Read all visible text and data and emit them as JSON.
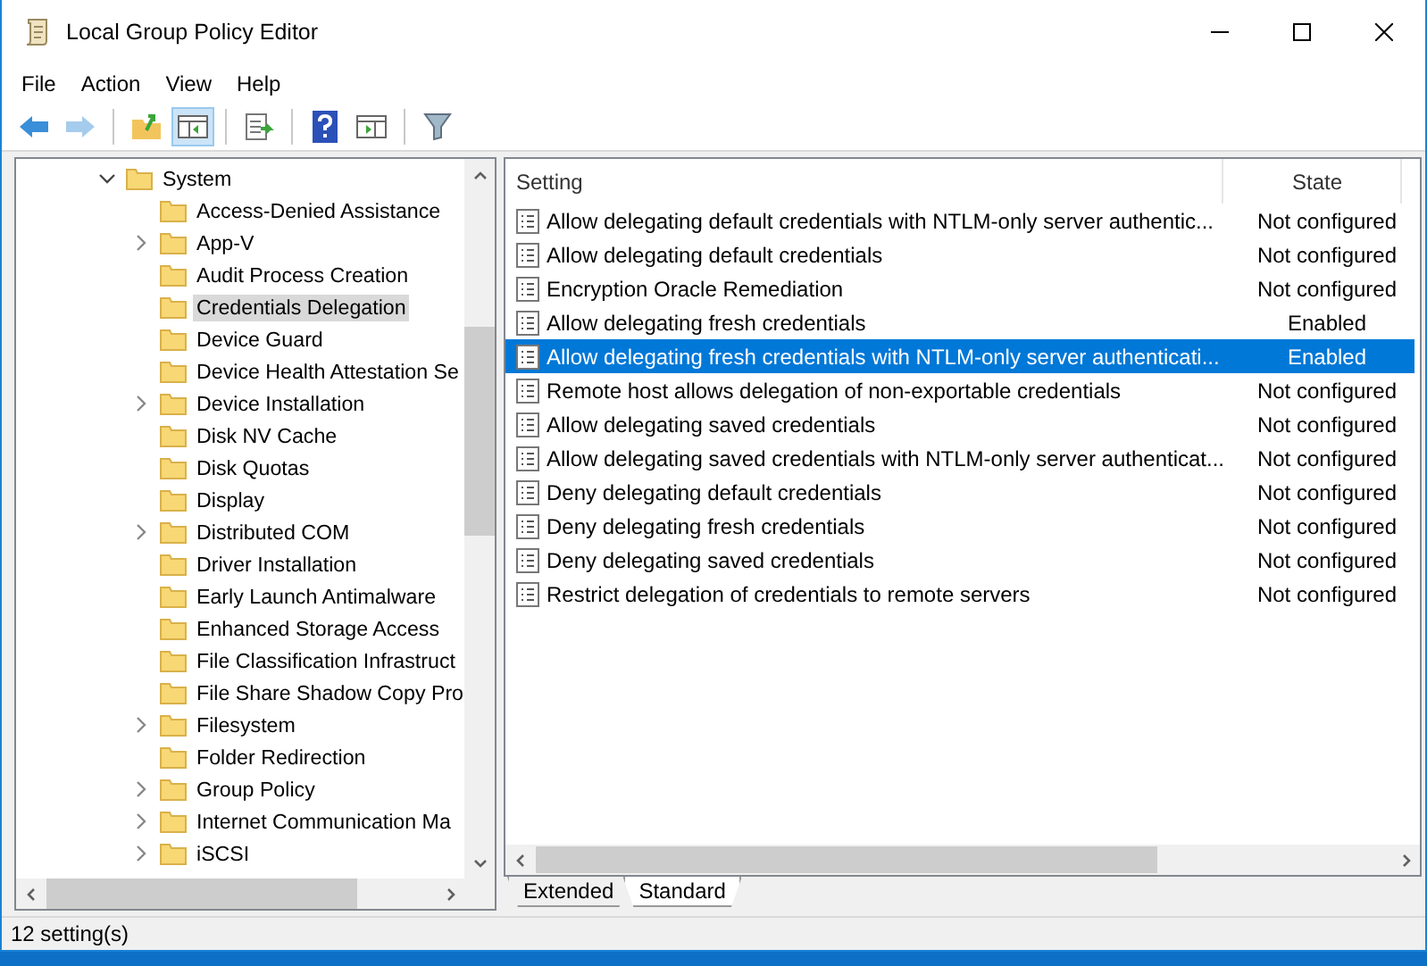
{
  "window": {
    "title": "Local Group Policy Editor"
  },
  "menu": [
    "File",
    "Action",
    "View",
    "Help"
  ],
  "toolbar": [
    {
      "kind": "back",
      "disabled": false,
      "pressed": false
    },
    {
      "kind": "forward",
      "disabled": true,
      "pressed": false
    },
    {
      "kind": "separator"
    },
    {
      "kind": "up",
      "disabled": false,
      "pressed": false
    },
    {
      "kind": "tree",
      "disabled": false,
      "pressed": true
    },
    {
      "kind": "separator"
    },
    {
      "kind": "export",
      "disabled": false,
      "pressed": false
    },
    {
      "kind": "separator"
    },
    {
      "kind": "help",
      "disabled": false,
      "pressed": false
    },
    {
      "kind": "pane",
      "disabled": false,
      "pressed": false
    },
    {
      "kind": "separator"
    },
    {
      "kind": "filter",
      "disabled": false,
      "pressed": false
    }
  ],
  "tree": [
    {
      "label": "System",
      "expanded": true,
      "selected": false,
      "children": [
        {
          "label": "Access-Denied Assistance",
          "expandable": false,
          "selected": false
        },
        {
          "label": "App-V",
          "expandable": true,
          "selected": false
        },
        {
          "label": "Audit Process Creation",
          "expandable": false,
          "selected": false
        },
        {
          "label": "Credentials Delegation",
          "expandable": false,
          "selected": true
        },
        {
          "label": "Device Guard",
          "expandable": false,
          "selected": false
        },
        {
          "label": "Device Health Attestation Se",
          "expandable": false,
          "selected": false
        },
        {
          "label": "Device Installation",
          "expandable": true,
          "selected": false
        },
        {
          "label": "Disk NV Cache",
          "expandable": false,
          "selected": false
        },
        {
          "label": "Disk Quotas",
          "expandable": false,
          "selected": false
        },
        {
          "label": "Display",
          "expandable": false,
          "selected": false
        },
        {
          "label": "Distributed COM",
          "expandable": true,
          "selected": false
        },
        {
          "label": "Driver Installation",
          "expandable": false,
          "selected": false
        },
        {
          "label": "Early Launch Antimalware",
          "expandable": false,
          "selected": false
        },
        {
          "label": "Enhanced Storage Access",
          "expandable": false,
          "selected": false
        },
        {
          "label": "File Classification Infrastruct",
          "expandable": false,
          "selected": false
        },
        {
          "label": "File Share Shadow Copy Pro",
          "expandable": false,
          "selected": false
        },
        {
          "label": "Filesystem",
          "expandable": true,
          "selected": false
        },
        {
          "label": "Folder Redirection",
          "expandable": false,
          "selected": false
        },
        {
          "label": "Group Policy",
          "expandable": true,
          "selected": false
        },
        {
          "label": "Internet Communication Ma",
          "expandable": true,
          "selected": false
        },
        {
          "label": "iSCSI",
          "expandable": true,
          "selected": false
        }
      ]
    }
  ],
  "table": {
    "columns": [
      "Setting",
      "State"
    ],
    "rows": [
      {
        "setting": "Allow delegating default credentials with NTLM-only server authentic...",
        "state": "Not configured",
        "selected": false
      },
      {
        "setting": "Allow delegating default credentials",
        "state": "Not configured",
        "selected": false
      },
      {
        "setting": "Encryption Oracle Remediation",
        "state": "Not configured",
        "selected": false
      },
      {
        "setting": "Allow delegating fresh credentials",
        "state": "Enabled",
        "selected": false
      },
      {
        "setting": "Allow delegating fresh credentials with NTLM-only server authenticati...",
        "state": "Enabled",
        "selected": true
      },
      {
        "setting": "Remote host allows delegation of non-exportable credentials",
        "state": "Not configured",
        "selected": false
      },
      {
        "setting": "Allow delegating saved credentials",
        "state": "Not configured",
        "selected": false
      },
      {
        "setting": "Allow delegating saved credentials with NTLM-only server authenticat...",
        "state": "Not configured",
        "selected": false
      },
      {
        "setting": "Deny delegating default credentials",
        "state": "Not configured",
        "selected": false
      },
      {
        "setting": "Deny delegating fresh credentials",
        "state": "Not configured",
        "selected": false
      },
      {
        "setting": "Deny delegating saved credentials",
        "state": "Not configured",
        "selected": false
      },
      {
        "setting": "Restrict delegation of credentials to remote servers",
        "state": "Not configured",
        "selected": false
      }
    ]
  },
  "tabs": [
    {
      "label": "Extended",
      "selected": false
    },
    {
      "label": "Standard",
      "selected": true
    }
  ],
  "status_bar": "12 setting(s)"
}
